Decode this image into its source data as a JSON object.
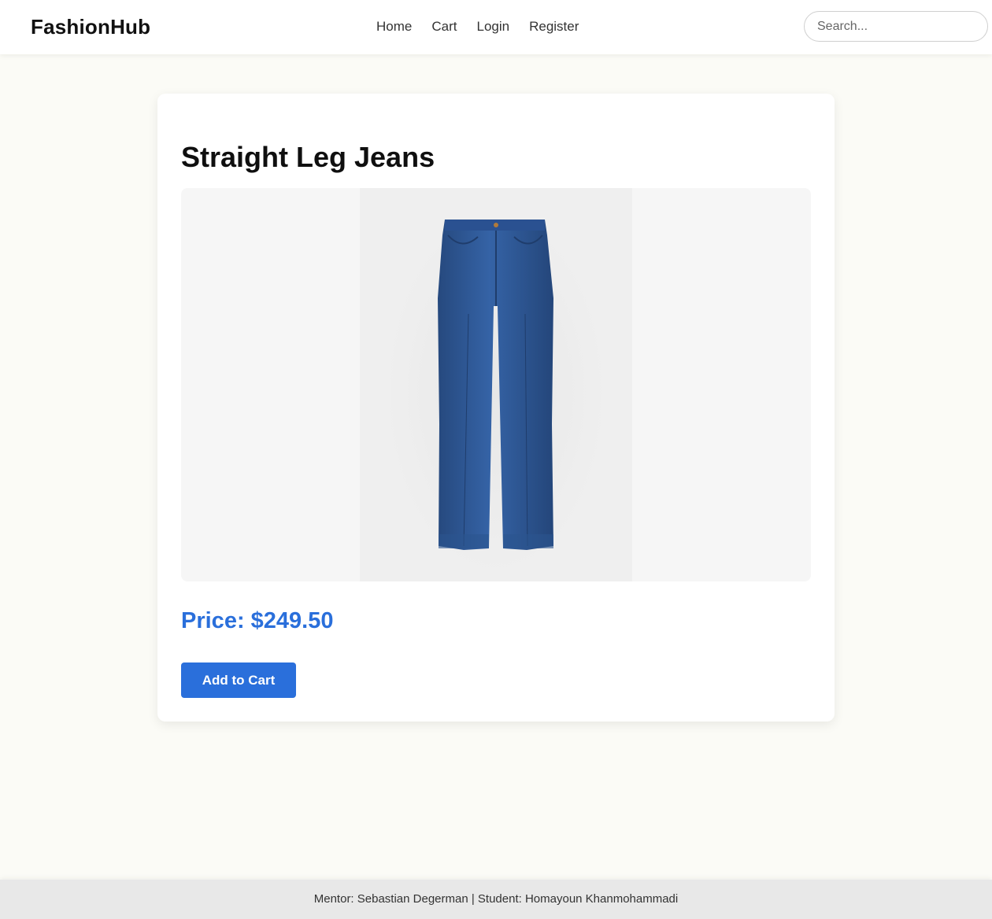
{
  "header": {
    "brand": "FashionHub",
    "nav": [
      "Home",
      "Cart",
      "Login",
      "Register"
    ],
    "search_placeholder": "Search..."
  },
  "product": {
    "title": "Straight Leg Jeans",
    "price_label": "Price: $249.50",
    "add_to_cart_label": "Add to Cart",
    "image_subject": "blue denim jeans"
  },
  "footer": {
    "text": "Mentor: Sebastian Degerman | Student: Homayoun Khanmohammadi"
  },
  "colors": {
    "accent": "#2a6fdb",
    "page_bg": "#fbfbf6",
    "denim": "#2f5a98"
  }
}
